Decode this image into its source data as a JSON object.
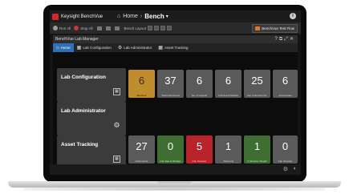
{
  "app": {
    "name": "Keysight BenchVue",
    "nav_home": "Home",
    "nav_separator": "›",
    "nav_bench": "Bench",
    "nav_bench_caret": "▾"
  },
  "toolbar": {
    "run_label": "Run All",
    "stop_label": "Stop All",
    "layout_label": "Bench Layout",
    "test_flow_label": "BenchVue Test Flow"
  },
  "panel": {
    "title": "BenchVue Lab Manager"
  },
  "tabs": [
    {
      "label": "Home"
    },
    {
      "label": "Lab Configuration"
    },
    {
      "label": "Lab Administrator"
    },
    {
      "label": "Asset Tracking"
    }
  ],
  "groups": [
    {
      "title": "Lab Configuration",
      "icon": "grid-icon"
    },
    {
      "title": "Lab Administrator",
      "icon": "gear-icon"
    },
    {
      "title": "Asset Tracking",
      "icon": "grid-icon"
    }
  ],
  "lab_config_tiles": [
    {
      "value": "6",
      "label": "Benches"
    },
    {
      "value": "37",
      "label": "Total Instruments"
    },
    {
      "value": "6",
      "label": "No. of Layouts"
    },
    {
      "value": "6",
      "label": "Instrument Models"
    },
    {
      "value": "25",
      "label": "Cal. Unknown Inst."
    },
    {
      "value": "6",
      "label": "Accessories"
    }
  ],
  "asset_tiles": [
    {
      "value": "27",
      "label": "Instruments"
    },
    {
      "value": "0",
      "label": "Cal. Due in 30 days"
    },
    {
      "value": "5",
      "label": "Cal. Overdue"
    },
    {
      "value": "1",
      "label": "Total Lost"
    },
    {
      "value": "1",
      "label": "In Service / Repair"
    },
    {
      "value": "0",
      "label": "Cal. Overdue"
    }
  ],
  "colors": {
    "accent_tab": "#2f6fb5",
    "tile_highlight": "#c08d2e",
    "tile_ok": "#3e6e32",
    "tile_alert": "#b8242a"
  }
}
